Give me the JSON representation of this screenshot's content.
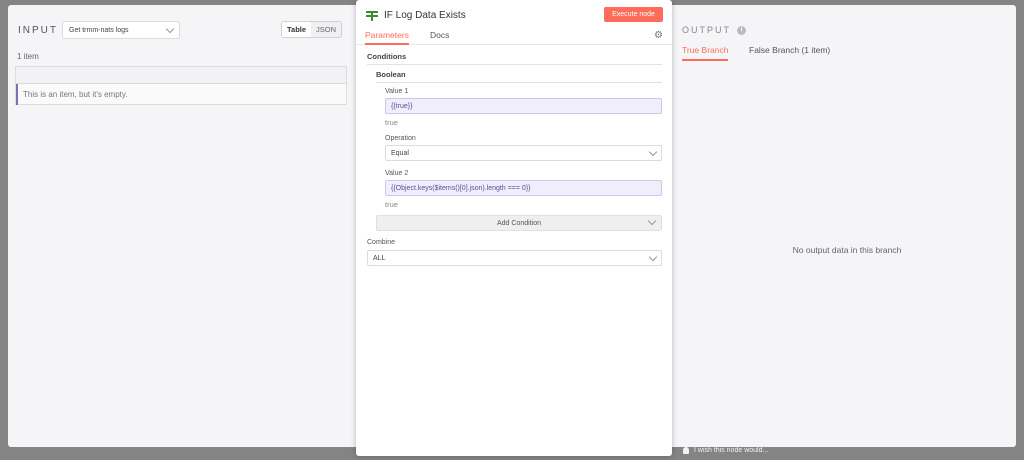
{
  "input": {
    "title": "INPUT",
    "node_select": "Get trmm-nats logs",
    "view_table": "Table",
    "view_json": "JSON",
    "item_count": "1 item",
    "empty_message": "This is an item, but it's empty."
  },
  "node": {
    "title": "IF Log Data Exists",
    "execute_label": "Execute node",
    "tabs": [
      "Parameters",
      "Docs"
    ],
    "conditions_label": "Conditions",
    "boolean_label": "Boolean",
    "value1_label": "Value 1",
    "value1_expr": "{{true}}",
    "value1_result": "true",
    "operation_label": "Operation",
    "operation_value": "Equal",
    "value2_label": "Value 2",
    "value2_expr": "{{Object.keys($items()[0].json).length === 0}}",
    "value2_result": "true",
    "add_condition": "Add Condition",
    "combine_label": "Combine",
    "combine_value": "ALL"
  },
  "output": {
    "title": "OUTPUT",
    "tabs": [
      "True Branch",
      "False Branch (1 item)"
    ],
    "empty_message": "No output data in this branch"
  },
  "feedback": "I wish this node would...",
  "colors": {
    "accent": "#ff6d5a",
    "expression_bg": "#f1eefb",
    "if_icon": "#3c8a2e"
  }
}
